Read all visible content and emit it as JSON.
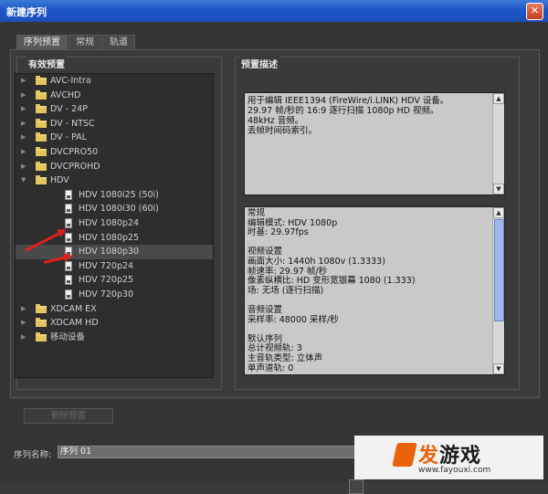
{
  "window": {
    "title": "新建序列",
    "close_icon": "close-icon"
  },
  "tabs": [
    {
      "label": "序列预置",
      "active": true
    },
    {
      "label": "常规",
      "active": false
    },
    {
      "label": "轨道",
      "active": false
    }
  ],
  "presets": {
    "title": "有效预置",
    "items": [
      {
        "label": "AVC-Intra",
        "type": "folder",
        "expanded": false
      },
      {
        "label": "AVCHD",
        "type": "folder",
        "expanded": false
      },
      {
        "label": "DV - 24P",
        "type": "folder",
        "expanded": false
      },
      {
        "label": "DV - NTSC",
        "type": "folder",
        "expanded": false
      },
      {
        "label": "DV - PAL",
        "type": "folder",
        "expanded": false
      },
      {
        "label": "DVCPRO50",
        "type": "folder",
        "expanded": false
      },
      {
        "label": "DVCPROHD",
        "type": "folder",
        "expanded": false
      },
      {
        "label": "HDV",
        "type": "folder",
        "expanded": true
      },
      {
        "label": "HDV 1080i25 (50i)",
        "type": "file"
      },
      {
        "label": "HDV 1080i30 (60i)",
        "type": "file"
      },
      {
        "label": "HDV 1080p24",
        "type": "file"
      },
      {
        "label": "HDV 1080p25",
        "type": "file"
      },
      {
        "label": "HDV 1080p30",
        "type": "file",
        "selected": true
      },
      {
        "label": "HDV 720p24",
        "type": "file"
      },
      {
        "label": "HDV 720p25",
        "type": "file"
      },
      {
        "label": "HDV 720p30",
        "type": "file"
      },
      {
        "label": "XDCAM EX",
        "type": "folder",
        "expanded": false
      },
      {
        "label": "XDCAM HD",
        "type": "folder",
        "expanded": false
      },
      {
        "label": "移动设备",
        "type": "folder",
        "expanded": false
      }
    ]
  },
  "description": {
    "title": "预置描述",
    "lines": [
      "用于编辑 IEEE1394 (FireWire/i.LINK) HDV 设备。",
      "29.97 帧/秒的 16:9 逐行扫描 1080p HD 视频。",
      "48kHz 音频。",
      "丢帧时间码索引。"
    ]
  },
  "settings_lines": [
    "常规",
    " 编辑模式: HDV 1080p",
    " 时基: 29.97fps",
    "",
    "视频设置",
    " 画面大小: 1440h 1080v (1.3333)",
    " 帧速率: 29.97 帧/秒",
    " 像素纵横比: HD 变形宽银幕 1080 (1.333)",
    " 场: 无场 (逐行扫描)",
    "",
    "音频设置",
    " 采样率: 48000 采样/秒",
    "",
    "默认序列",
    " 总计视频轨: 3",
    " 主音轨类型: 立体声",
    " 单声道轨: 0"
  ],
  "delete_button": "删除预置",
  "sequence_name": {
    "label": "序列名称:",
    "value": "序列 01"
  },
  "watermark": {
    "logo_first": "发",
    "logo_rest": "游戏",
    "url": "www.fayouxi.com"
  },
  "colors": {
    "titlebar": "#1f56c6",
    "arrow": "#e01e1e",
    "folder": "#e3c55e",
    "watermark_accent": "#e8630a"
  }
}
